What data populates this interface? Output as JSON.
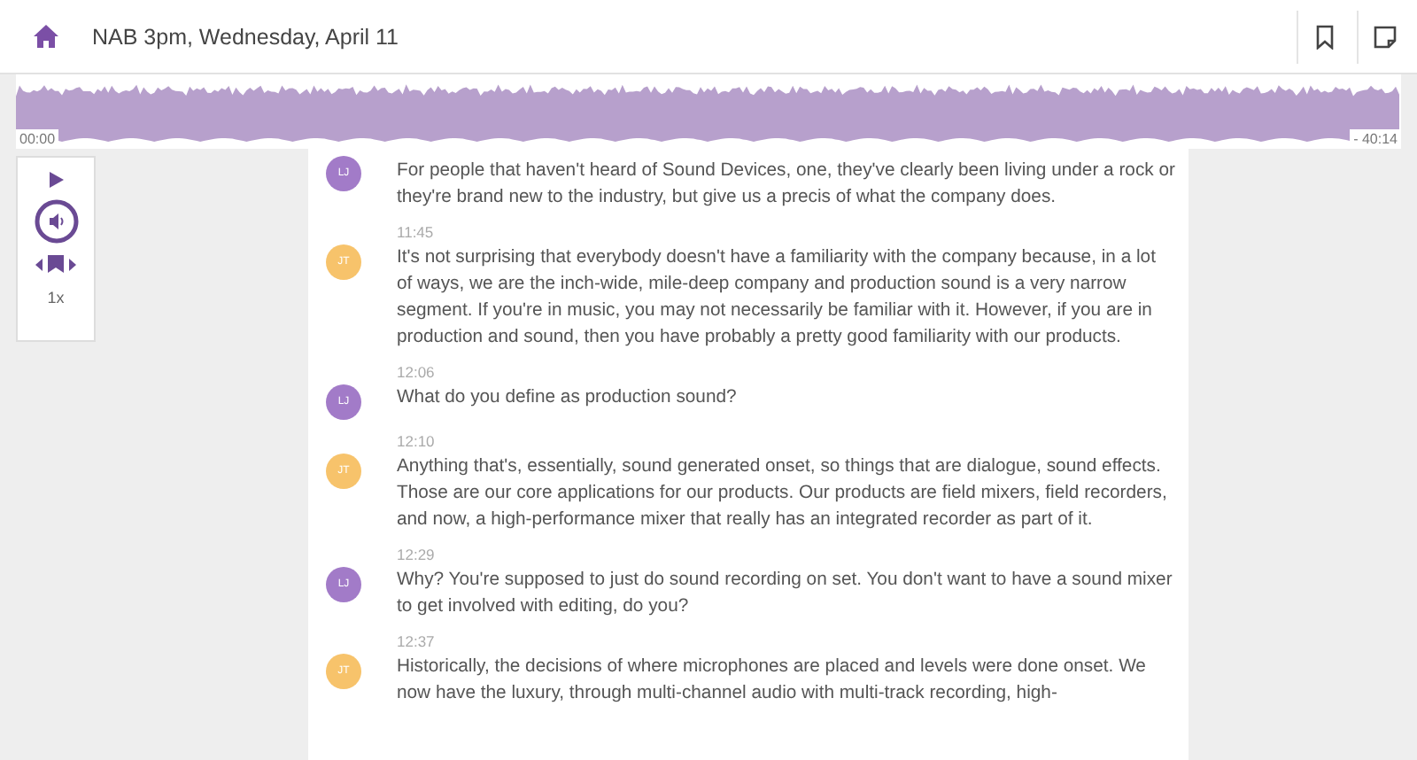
{
  "header": {
    "title": "NAB 3pm, Wednesday, April 11"
  },
  "waveform": {
    "start_time": "00:00",
    "remaining_time": "- 40:14"
  },
  "player": {
    "speed": "1x"
  },
  "transcript": [
    {
      "speaker": "LJ",
      "color": "#a27bc8",
      "text": "For people that haven't heard of Sound Devices, one, they've clearly been living under a rock or they're brand new to the industry, but give us a precis of what the company does."
    },
    {
      "speaker": "JT",
      "color": "#f7c36b",
      "time": "11:45",
      "text": "It's not surprising that everybody doesn't have a familiarity with the company because, in a lot of ways, we are the inch-wide, mile-deep company and production sound is a very narrow segment. If you're in music, you may not necessarily be familiar with it. However, if you are in production and sound, then you have probably a pretty good familiarity with our products."
    },
    {
      "speaker": "LJ",
      "color": "#a27bc8",
      "time": "12:06",
      "text": "What do you define as production sound?"
    },
    {
      "speaker": "JT",
      "color": "#f7c36b",
      "time": "12:10",
      "text": "Anything that's, essentially, sound generated onset, so things that are dialogue, sound effects. Those are our core applications for our products. Our products are field mixers, field recorders, and now, a high-performance mixer that really has an integrated recorder as part of it."
    },
    {
      "speaker": "LJ",
      "color": "#a27bc8",
      "time": "12:29",
      "text": "Why? You're supposed to just do sound recording on set. You don't want to have a sound mixer to get involved with editing, do you?"
    },
    {
      "speaker": "JT",
      "color": "#f7c36b",
      "time": "12:37",
      "text": "Historically, the decisions of where microphones are placed and levels were done onset. We now have the luxury, through multi-channel audio with multi-track recording, high-"
    }
  ]
}
